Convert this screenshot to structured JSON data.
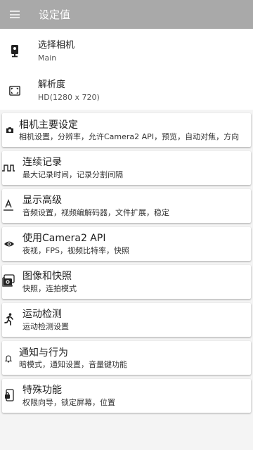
{
  "appbar": {
    "title": "设定值"
  },
  "top_items": [
    {
      "primary": "选择相机",
      "secondary": "Main",
      "icon": "camera-select-icon"
    },
    {
      "primary": "解析度",
      "secondary": "HD(1280 x 720)",
      "icon": "resolution-icon"
    }
  ],
  "cards": [
    {
      "primary": "相机主要设定",
      "secondary": "相机设置，分辨率，允许Camera2 API，预览，自动对焦，方向",
      "icon": "camera-icon"
    },
    {
      "primary": "连续记录",
      "secondary": "最大记录时间，记录分割间隔",
      "icon": "pulse-wave-icon"
    },
    {
      "primary": "显示高级",
      "secondary": "音频设置，视频编解码器，文件扩展，稳定",
      "icon": "text-format-icon"
    },
    {
      "primary": "使用Camera2 API",
      "secondary": "夜视，FPS，视频比特率，快照",
      "icon": "eye-icon"
    },
    {
      "primary": "图像和快照",
      "secondary": "快照，连拍模式",
      "icon": "burst-camera-icon"
    },
    {
      "primary": "运动检测",
      "secondary": "运动检测设置",
      "icon": "running-person-icon"
    },
    {
      "primary": "通知与行为",
      "secondary": "暗模式，通知设置，音量键功能",
      "icon": "bell-icon"
    },
    {
      "primary": "特殊功能",
      "secondary": "权限向导，锁定屏幕，位置",
      "icon": "phone-lock-icon"
    }
  ]
}
